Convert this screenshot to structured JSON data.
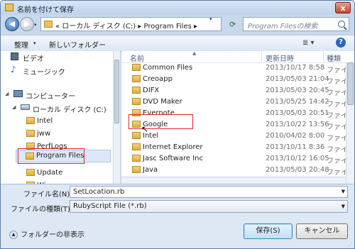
{
  "window": {
    "title": "名前を付けて保存",
    "close_label": "x"
  },
  "nav": {
    "back_glyph": "◀",
    "forward_glyph": "▶",
    "address": "« ローカル ディスク (C:) ▸ Program Files ▸",
    "search_placeholder": "Program Filesの検索"
  },
  "toolbar": {
    "organize_label": "整理",
    "new_folder_label": "新しいフォルダー",
    "view_glyph": "≣ ▾"
  },
  "sidebar": {
    "items": [
      {
        "label": "ビデオ"
      },
      {
        "label": "ミュージック"
      },
      {
        "label": "コンピューター"
      },
      {
        "label": "ローカル ディスク (C:)"
      },
      {
        "label": "Intel"
      },
      {
        "label": "jww"
      },
      {
        "label": "PerfLogs"
      },
      {
        "label": "Program Files"
      },
      {
        "label": "Update"
      },
      {
        "label": "Wi"
      }
    ]
  },
  "columns": {
    "name": "名前",
    "date": "更新日時",
    "type": "種類"
  },
  "files": [
    {
      "name": "Common Files",
      "date": "2013/10/17 8:58",
      "type": "ファイ"
    },
    {
      "name": "Creoapp",
      "date": "2013/05/03 21:04",
      "type": "ファイ"
    },
    {
      "name": "DIFX",
      "date": "2013/05/03 20:45",
      "type": "ファイ"
    },
    {
      "name": "DVD Maker",
      "date": "2013/05/25 14:42",
      "type": "ファイ"
    },
    {
      "name": "Evernote",
      "date": "2013/05/03 20:51",
      "type": "ファイ"
    },
    {
      "name": "Google",
      "date": "2013/10/22 13:56",
      "type": "ファイ"
    },
    {
      "name": "Intel",
      "date": "2010/04/02 8:00",
      "type": "ファイ"
    },
    {
      "name": "Internet Explorer",
      "date": "2013/10/11 8:36",
      "type": "ファイ"
    },
    {
      "name": "Jasc Software Inc",
      "date": "2013/10/12 16:05",
      "type": "ファイ"
    },
    {
      "name": "Java",
      "date": "2013/05/03 20:48",
      "type": "ファイ"
    }
  ],
  "footer": {
    "filename_label": "ファイル名(N):",
    "filename_value": "SetLocation.rb",
    "filetype_label": "ファイルの種類(T):",
    "filetype_value": "RubyScript File (*.rb)",
    "hide_folders_label": "フォルダーの非表示",
    "save_label": "保存(S)",
    "cancel_label": "キャンセル"
  }
}
